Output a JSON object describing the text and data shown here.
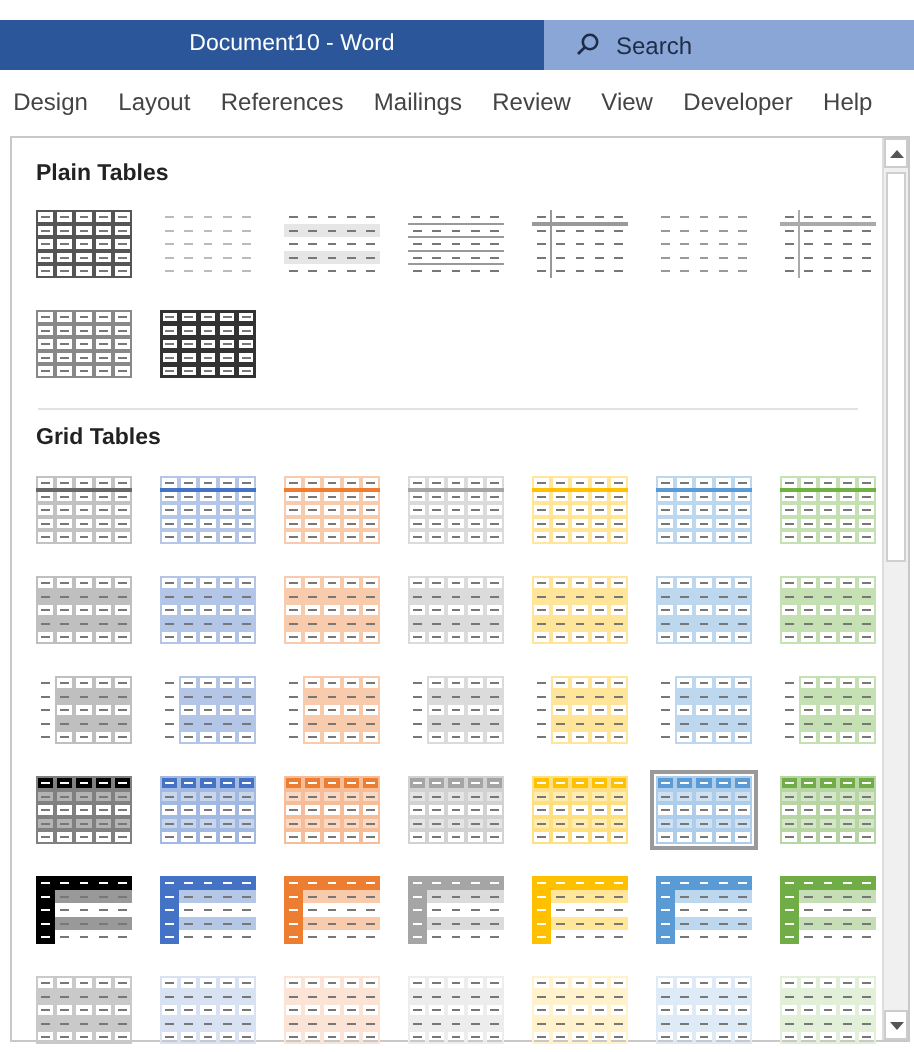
{
  "window": {
    "title": "Document10  -  Word",
    "search": {
      "placeholder": "Search"
    }
  },
  "ribbon_tabs": [
    {
      "label": "Design",
      "selected": false
    },
    {
      "label": "Layout",
      "selected": false
    },
    {
      "label": "References",
      "selected": false
    },
    {
      "label": "Mailings",
      "selected": false
    },
    {
      "label": "Review",
      "selected": false
    },
    {
      "label": "View",
      "selected": false
    },
    {
      "label": "Developer",
      "selected": false
    },
    {
      "label": "Help",
      "selected": false
    }
  ],
  "gallery": {
    "sections": [
      {
        "title": "Plain Tables",
        "styles": [
          {
            "kind": "full-grid",
            "color": "#555555",
            "selected": false
          },
          {
            "kind": "dashes",
            "color": "#bbbbbb",
            "selected": false
          },
          {
            "kind": "banded",
            "color": "#e6e6e6",
            "selected": false
          },
          {
            "kind": "header-lines",
            "color": "#999999",
            "selected": false
          },
          {
            "kind": "first-col-line",
            "color": "#999999",
            "selected": false
          },
          {
            "kind": "dashes",
            "color": "#999999",
            "selected": false
          },
          {
            "kind": "first-col-line",
            "color": "#aaaaaa",
            "selected": false
          },
          {
            "kind": "full-grid",
            "color": "#888888",
            "selected": false
          },
          {
            "kind": "bold-grid",
            "color": "#333333",
            "selected": false
          }
        ]
      },
      {
        "title": "Grid Tables",
        "styles": [
          {
            "kind": "grid-light",
            "color": "#c2c2c2",
            "selected": false
          },
          {
            "kind": "grid-light",
            "color": "#b4c7e7",
            "selected": false
          },
          {
            "kind": "grid-light",
            "color": "#f8cbad",
            "selected": false
          },
          {
            "kind": "grid-light",
            "color": "#dbdbdb",
            "selected": false
          },
          {
            "kind": "grid-light",
            "color": "#ffe699",
            "selected": false
          },
          {
            "kind": "grid-light",
            "color": "#bdd7ee",
            "selected": false
          },
          {
            "kind": "grid-light",
            "color": "#c5e0b3",
            "selected": false
          },
          {
            "kind": "grid-banded",
            "color": "#bfbfbf",
            "selected": false
          },
          {
            "kind": "grid-banded",
            "color": "#b4c6e7",
            "selected": false
          },
          {
            "kind": "grid-banded",
            "color": "#f8cbad",
            "selected": false
          },
          {
            "kind": "grid-banded",
            "color": "#dbdbdb",
            "selected": false
          },
          {
            "kind": "grid-banded",
            "color": "#ffe599",
            "selected": false
          },
          {
            "kind": "grid-banded",
            "color": "#bdd7ee",
            "selected": false
          },
          {
            "kind": "grid-banded",
            "color": "#c5e0b3",
            "selected": false
          },
          {
            "kind": "grid-banded-first-col",
            "color": "#bfbfbf",
            "selected": false
          },
          {
            "kind": "grid-banded-first-col",
            "color": "#b4c6e7",
            "selected": false
          },
          {
            "kind": "grid-banded-first-col",
            "color": "#f8cbad",
            "selected": false
          },
          {
            "kind": "grid-banded-first-col",
            "color": "#dbdbdb",
            "selected": false
          },
          {
            "kind": "grid-banded-first-col",
            "color": "#ffe599",
            "selected": false
          },
          {
            "kind": "grid-banded-first-col",
            "color": "#bdd7ee",
            "selected": false
          },
          {
            "kind": "grid-banded-first-col",
            "color": "#c5e0b3",
            "selected": false
          },
          {
            "kind": "grid-header",
            "color": "#000000",
            "selected": false
          },
          {
            "kind": "grid-header",
            "color": "#4472c4",
            "selected": false
          },
          {
            "kind": "grid-header",
            "color": "#ed7d31",
            "selected": false
          },
          {
            "kind": "grid-header",
            "color": "#a5a5a5",
            "selected": false
          },
          {
            "kind": "grid-header",
            "color": "#ffc000",
            "selected": false
          },
          {
            "kind": "grid-header",
            "color": "#5b9bd5",
            "selected": true
          },
          {
            "kind": "grid-header",
            "color": "#70ad47",
            "selected": false
          },
          {
            "kind": "grid-header-first-col",
            "color": "#000000",
            "selected": false
          },
          {
            "kind": "grid-header-first-col",
            "color": "#4472c4",
            "selected": false
          },
          {
            "kind": "grid-header-first-col",
            "color": "#ed7d31",
            "selected": false
          },
          {
            "kind": "grid-header-first-col",
            "color": "#a5a5a5",
            "selected": false
          },
          {
            "kind": "grid-header-first-col",
            "color": "#ffc000",
            "selected": false
          },
          {
            "kind": "grid-header-first-col",
            "color": "#5b9bd5",
            "selected": false
          },
          {
            "kind": "grid-header-first-col",
            "color": "#70ad47",
            "selected": false
          },
          {
            "kind": "grid-banded",
            "color": "#c9c9c9",
            "selected": false
          },
          {
            "kind": "grid-pale",
            "color": "#d9e2f3",
            "selected": false
          },
          {
            "kind": "grid-pale",
            "color": "#fbe4d5",
            "selected": false
          },
          {
            "kind": "grid-pale",
            "color": "#ededed",
            "selected": false
          },
          {
            "kind": "grid-pale",
            "color": "#fff2cc",
            "selected": false
          },
          {
            "kind": "grid-pale",
            "color": "#deeaf6",
            "selected": false
          },
          {
            "kind": "grid-pale",
            "color": "#e2efd9",
            "selected": false
          }
        ]
      }
    ]
  }
}
